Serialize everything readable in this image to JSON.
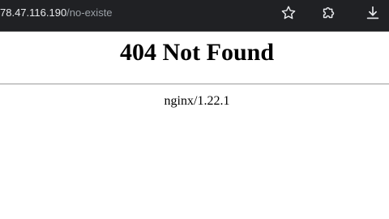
{
  "browser": {
    "url_host": "78.47.116.190",
    "url_path": "/no-existe",
    "icons": {
      "bookmark": "star-icon",
      "extensions": "puzzle-icon",
      "downloads": "download-icon"
    },
    "colors": {
      "toolbar_bg": "#202124",
      "url_host": "#e8eaed",
      "url_path": "#9aa0a6",
      "icon": "#e8eaed"
    }
  },
  "page": {
    "heading": "404 Not Found",
    "server": "nginx/1.22.1"
  }
}
